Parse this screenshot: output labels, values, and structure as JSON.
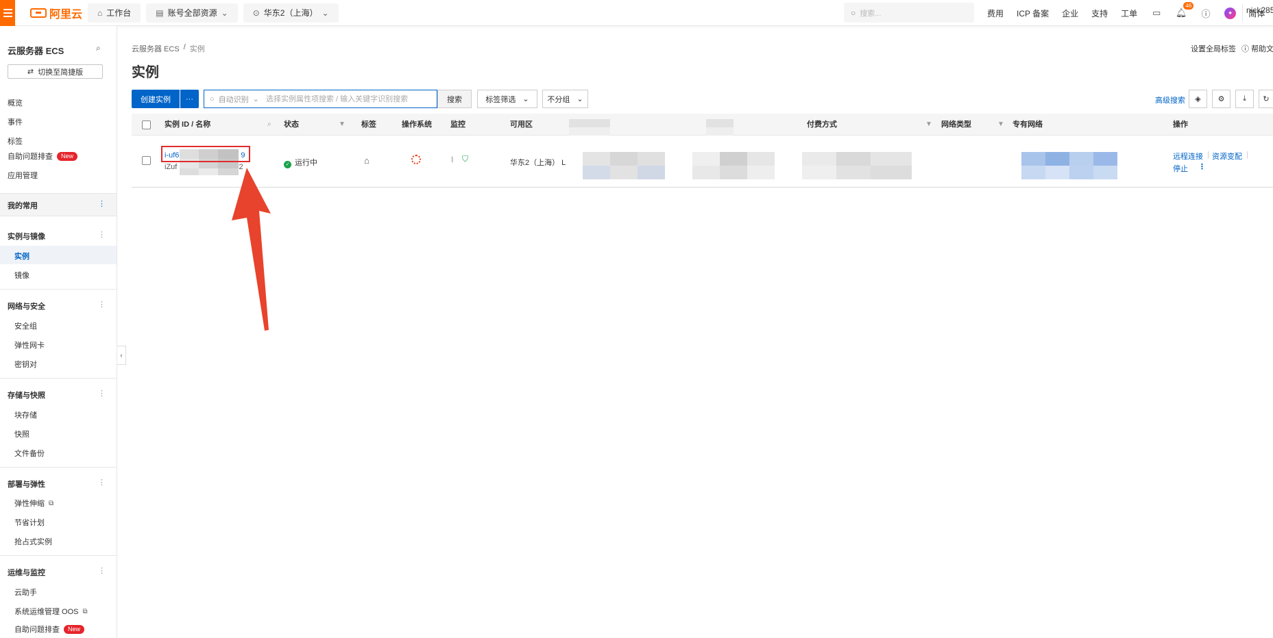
{
  "topbar": {
    "logo_text": "阿里云",
    "nav": [
      {
        "label": "工作台",
        "icon": "home-icon"
      },
      {
        "label": "账号全部资源",
        "icon": "list-icon"
      },
      {
        "label": "华东2（上海）",
        "icon": "location-icon"
      }
    ],
    "search_placeholder": "搜索...",
    "links": [
      "费用",
      "ICP 备案",
      "企业",
      "支持",
      "工单"
    ],
    "notification_count": "46",
    "language": "简体",
    "username": "nick285"
  },
  "sidebar": {
    "title": "云服务器 ECS",
    "switch_label": "切换至简捷版",
    "top_items": [
      "概览",
      "事件",
      "标签",
      "自助问题排查",
      "应用管理"
    ],
    "new_badge": "New",
    "favorites_label": "我的常用",
    "groups": [
      {
        "title": "实例与镜像",
        "items": [
          "实例",
          "镜像"
        ]
      },
      {
        "title": "网络与安全",
        "items": [
          "安全组",
          "弹性网卡",
          "密钥对"
        ]
      },
      {
        "title": "存储与快照",
        "items": [
          "块存储",
          "快照",
          "文件备份"
        ]
      },
      {
        "title": "部署与弹性",
        "items": [
          "弹性伸缩",
          "节省计划",
          "抢占式实例"
        ]
      },
      {
        "title": "运维与监控",
        "items": [
          "云助手",
          "系统运维管理 OOS",
          "自助问题排查"
        ]
      }
    ]
  },
  "main": {
    "breadcrumb": [
      "云服务器 ECS",
      "/",
      "实例"
    ],
    "title": "实例",
    "top_links": [
      "设置全局标签",
      "帮助文档"
    ],
    "toolbar": {
      "create_label": "创建实例",
      "more_label": "···",
      "search_type": "自动识别",
      "search_placeholder": "选择实例属性项搜索 / 输入关键字识别搜索",
      "search_button": "搜索",
      "tag_filter": "标签筛选",
      "group_label": "不分组",
      "advanced_search": "高级搜索"
    },
    "table": {
      "columns": [
        "实例 ID / 名称",
        "状态",
        "标签",
        "操作系统",
        "监控",
        "可用区",
        "付费方式",
        "网络类型",
        "专有网络",
        "操作"
      ],
      "row": {
        "id_prefix": "i-uf6",
        "id_suffix": "9",
        "name_prefix": "iZuf",
        "name_suffix": "92",
        "status": "运行中",
        "zone": "华东2（上海） L",
        "actions": [
          "远程连接",
          "资源变配",
          "停止"
        ]
      }
    }
  },
  "colors": {
    "brand": "#ff6a00",
    "primary": "#0064c8",
    "running": "#1aa44a",
    "highlight": "#e02b2b"
  }
}
